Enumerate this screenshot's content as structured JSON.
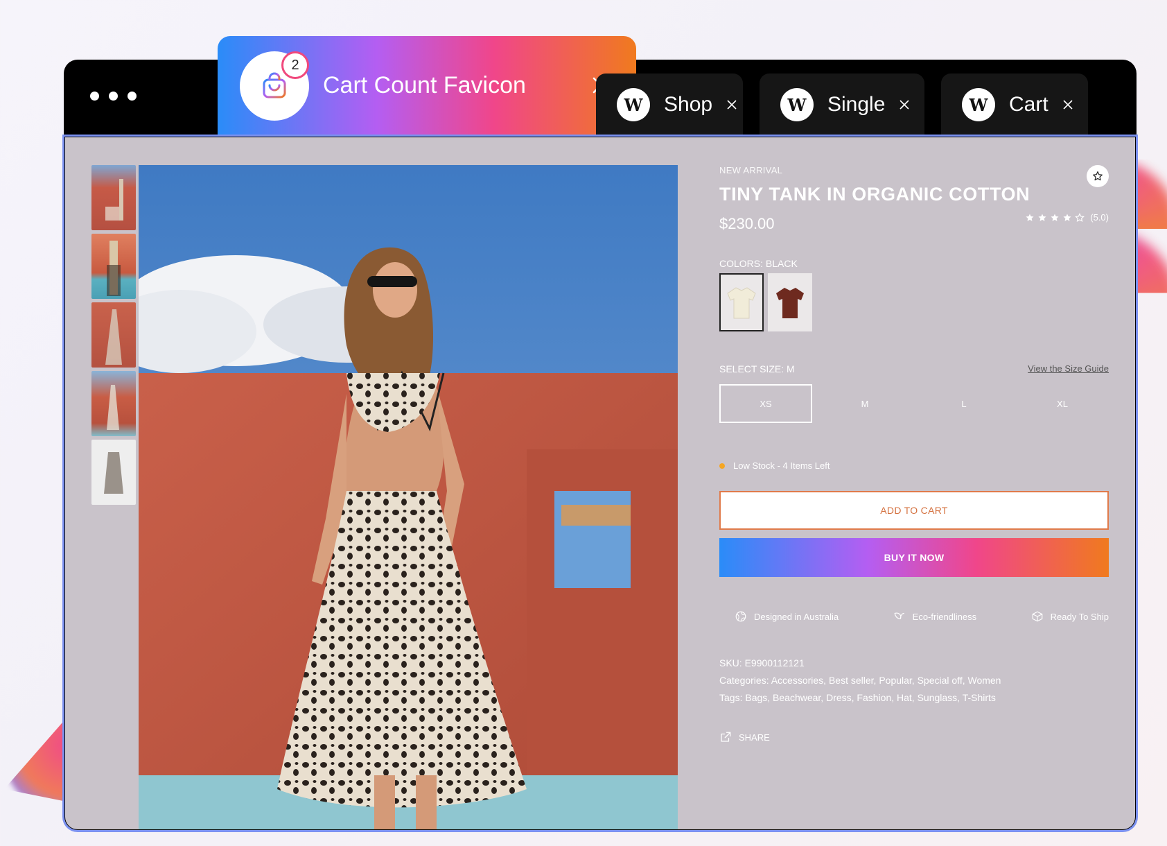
{
  "browser": {
    "active_tab": {
      "title": "Cart Count Favicon",
      "badge_count": "2"
    },
    "tabs": [
      {
        "label": "Shop",
        "logo": "W"
      },
      {
        "label": "Single",
        "logo": "W"
      },
      {
        "label": "Cart",
        "logo": "W"
      }
    ]
  },
  "product": {
    "eyebrow": "NEW ARRIVAL",
    "title": "TINY TANK IN ORGANIC COTTON",
    "price": "$230.00",
    "rating_text": "(5.0)",
    "rating_value": 5,
    "colors_label": "COLORS: BLACK",
    "colors": [
      {
        "name": "cream",
        "hex": "#f1ecd9",
        "selected": true
      },
      {
        "name": "brown",
        "hex": "#6e2a1f",
        "selected": false
      }
    ],
    "size_label": "SELECT SIZE: M",
    "size_guide": "View the Size Guide",
    "sizes": [
      "XS",
      "M",
      "L",
      "XL"
    ],
    "selected_size": "XS",
    "stock": "Low Stock - 4 Items Left",
    "add_to_cart": "ADD TO CART",
    "buy_now": "BUY IT NOW",
    "features": [
      {
        "label": "Designed in Australia",
        "icon": "globe-icon"
      },
      {
        "label": "Eco-friendliness",
        "icon": "leaf-icon"
      },
      {
        "label": "Ready To Ship",
        "icon": "box-icon"
      }
    ],
    "sku": "SKU: E9900112121",
    "categories": "Categories: Accessories, Best seller, Popular, Special off, Women",
    "tags": "Tags: Bags, Beachwear, Dress, Fashion, Hat, Sunglass, T-Shirts",
    "share": "SHARE"
  },
  "colors": {
    "accent_gradient": [
      "#2a8cf8",
      "#b45ef2",
      "#f0468a",
      "#f07a1e"
    ],
    "stock_dot": "#f5a623"
  }
}
